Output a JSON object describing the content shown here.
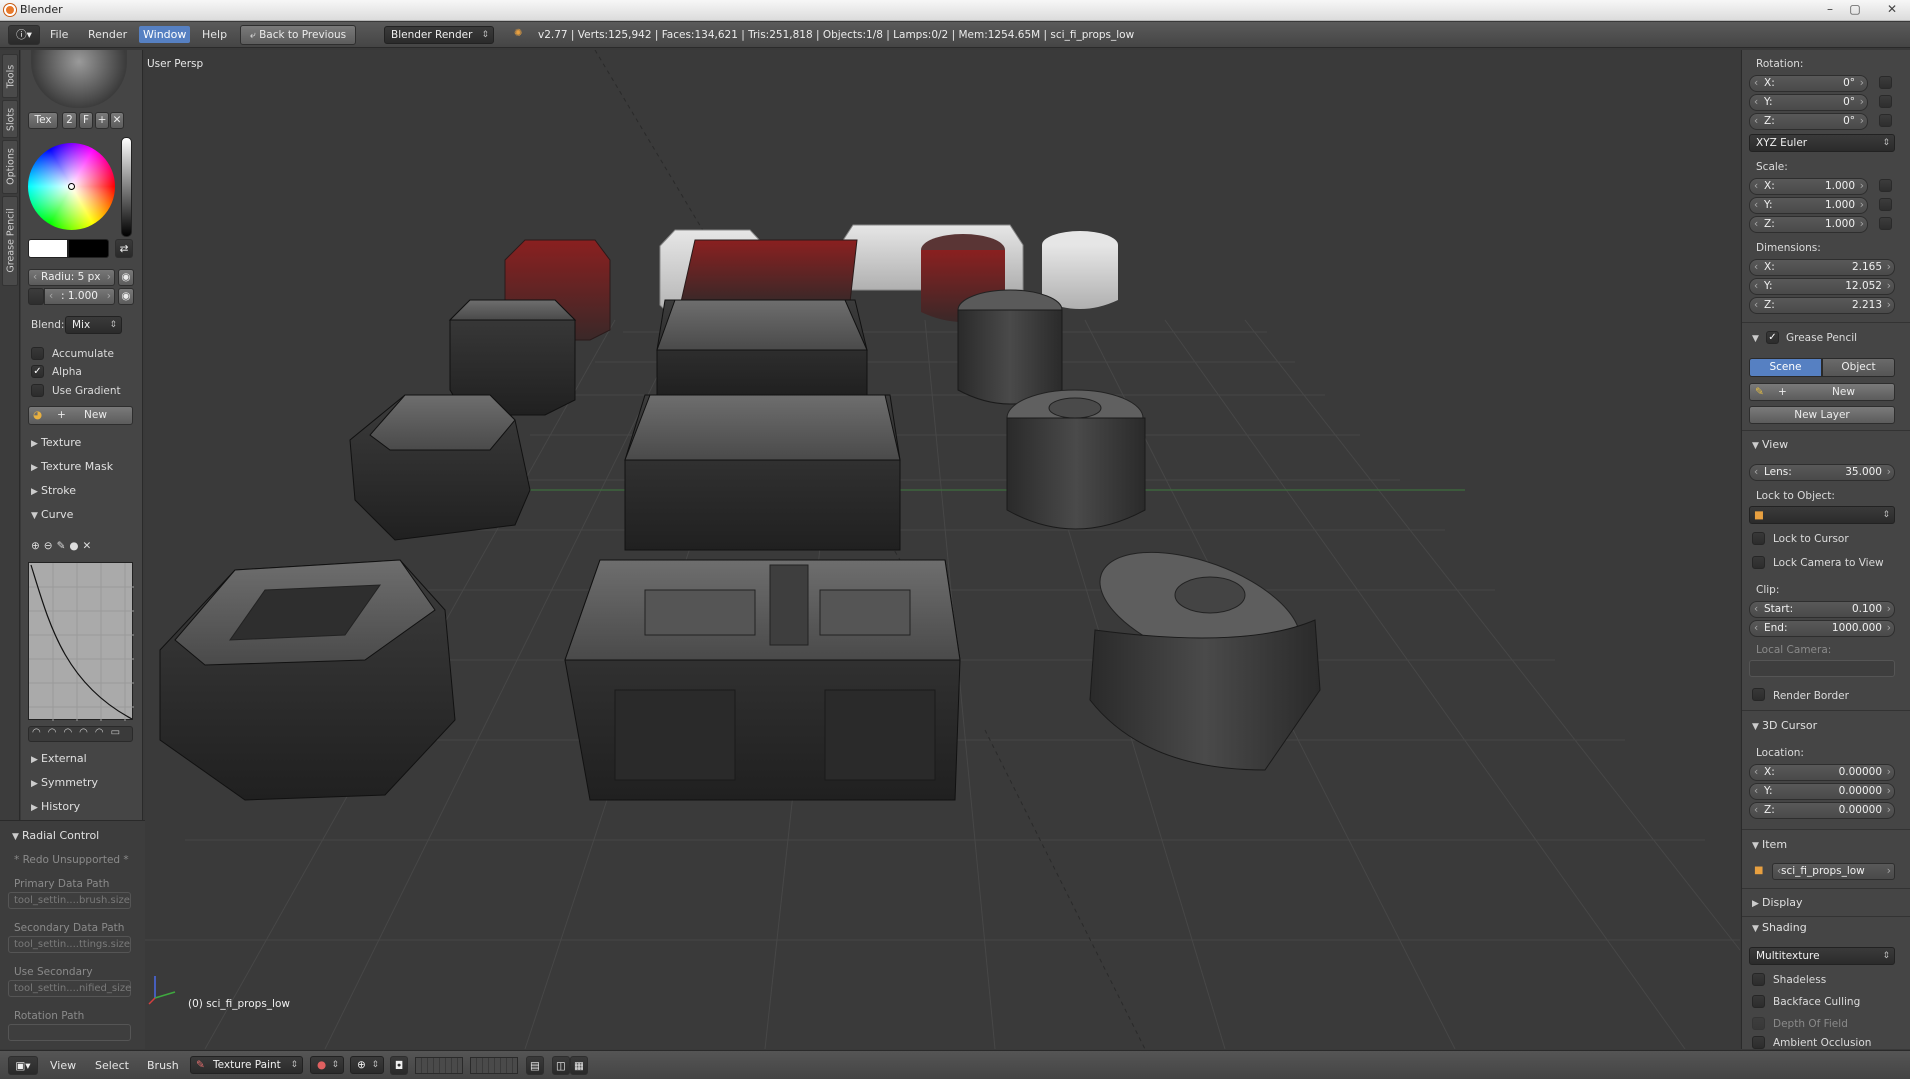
{
  "window": {
    "title": "Blender",
    "min": "–",
    "max": "▢",
    "close": "✕"
  },
  "menubar": {
    "items": [
      "File",
      "Render",
      "Window",
      "Help"
    ],
    "back": "Back to Previous",
    "engine": "Blender Render",
    "stats": "v2.77 | Verts:125,942 | Faces:134,621 | Tris:251,818 | Objects:1/8 | Lamps:0/2 | Mem:1254.65M | sci_fi_props_low"
  },
  "toolshelf_tabs": [
    "Tools",
    "Slots",
    "Options",
    "Grease Pencil"
  ],
  "left": {
    "tex_tab": "Tex",
    "tex_num": "2",
    "tex_f": "F",
    "radius": "Radiu: 5 px",
    "strength": ": 1.000",
    "blend_label": "Blend:",
    "blend_value": "Mix",
    "checkboxes": [
      {
        "label": "Accumulate",
        "checked": false
      },
      {
        "label": "Alpha",
        "checked": true
      },
      {
        "label": "Use Gradient",
        "checked": false
      }
    ],
    "new_btn": "New",
    "sections": [
      "Texture",
      "Texture Mask",
      "Stroke",
      "Curve",
      "External",
      "Symmetry",
      "History"
    ],
    "radial": {
      "title": "Radial Control",
      "redo": "* Redo Unsupported *",
      "primary_label": "Primary Data Path",
      "primary_value": "tool_settin....brush.size",
      "secondary_label": "Secondary Data Path",
      "secondary_value": "tool_settin....ttings.size",
      "use_secondary_label": "Use Secondary",
      "use_secondary_value": "tool_settin....nified_size",
      "rotation_label": "Rotation Path"
    }
  },
  "viewport": {
    "label": "User Persp",
    "object": "(0) sci_fi_props_low"
  },
  "right": {
    "rotation_label": "Rotation:",
    "rotation": [
      {
        "k": "X:",
        "v": "0°"
      },
      {
        "k": "Y:",
        "v": "0°"
      },
      {
        "k": "Z:",
        "v": "0°"
      }
    ],
    "rotation_mode": "XYZ Euler",
    "scale_label": "Scale:",
    "scale": [
      {
        "k": "X:",
        "v": "1.000"
      },
      {
        "k": "Y:",
        "v": "1.000"
      },
      {
        "k": "Z:",
        "v": "1.000"
      }
    ],
    "dimensions_label": "Dimensions:",
    "dimensions": [
      {
        "k": "X:",
        "v": "2.165"
      },
      {
        "k": "Y:",
        "v": "12.052"
      },
      {
        "k": "Z:",
        "v": "2.213"
      }
    ],
    "grease_pencil": "Grease Pencil",
    "scene": "Scene",
    "object": "Object",
    "new": "New",
    "new_layer": "New Layer",
    "view": "View",
    "lens_k": "Lens:",
    "lens_v": "35.000",
    "lock_to_object": "Lock to Object:",
    "lock_to_cursor": "Lock to Cursor",
    "lock_camera": "Lock Camera to View",
    "clip": "Clip:",
    "start_k": "Start:",
    "start_v": "0.100",
    "end_k": "End:",
    "end_v": "1000.000",
    "local_camera": "Local Camera:",
    "render_border": "Render Border",
    "cursor": "3D Cursor",
    "location": "Location:",
    "cursor_loc": [
      {
        "k": "X:",
        "v": "0.00000"
      },
      {
        "k": "Y:",
        "v": "0.00000"
      },
      {
        "k": "Z:",
        "v": "0.00000"
      }
    ],
    "item": "Item",
    "item_name": "sci_fi_props_low",
    "display": "Display",
    "shading": "Shading",
    "shading_mode": "Multitexture",
    "shadeless": "Shadeless",
    "backface": "Backface Culling",
    "dof": "Depth Of Field",
    "ao": "Ambient Occlusion"
  },
  "bottombar": {
    "view": "View",
    "select": "Select",
    "brush": "Brush",
    "mode": "Texture Paint"
  }
}
